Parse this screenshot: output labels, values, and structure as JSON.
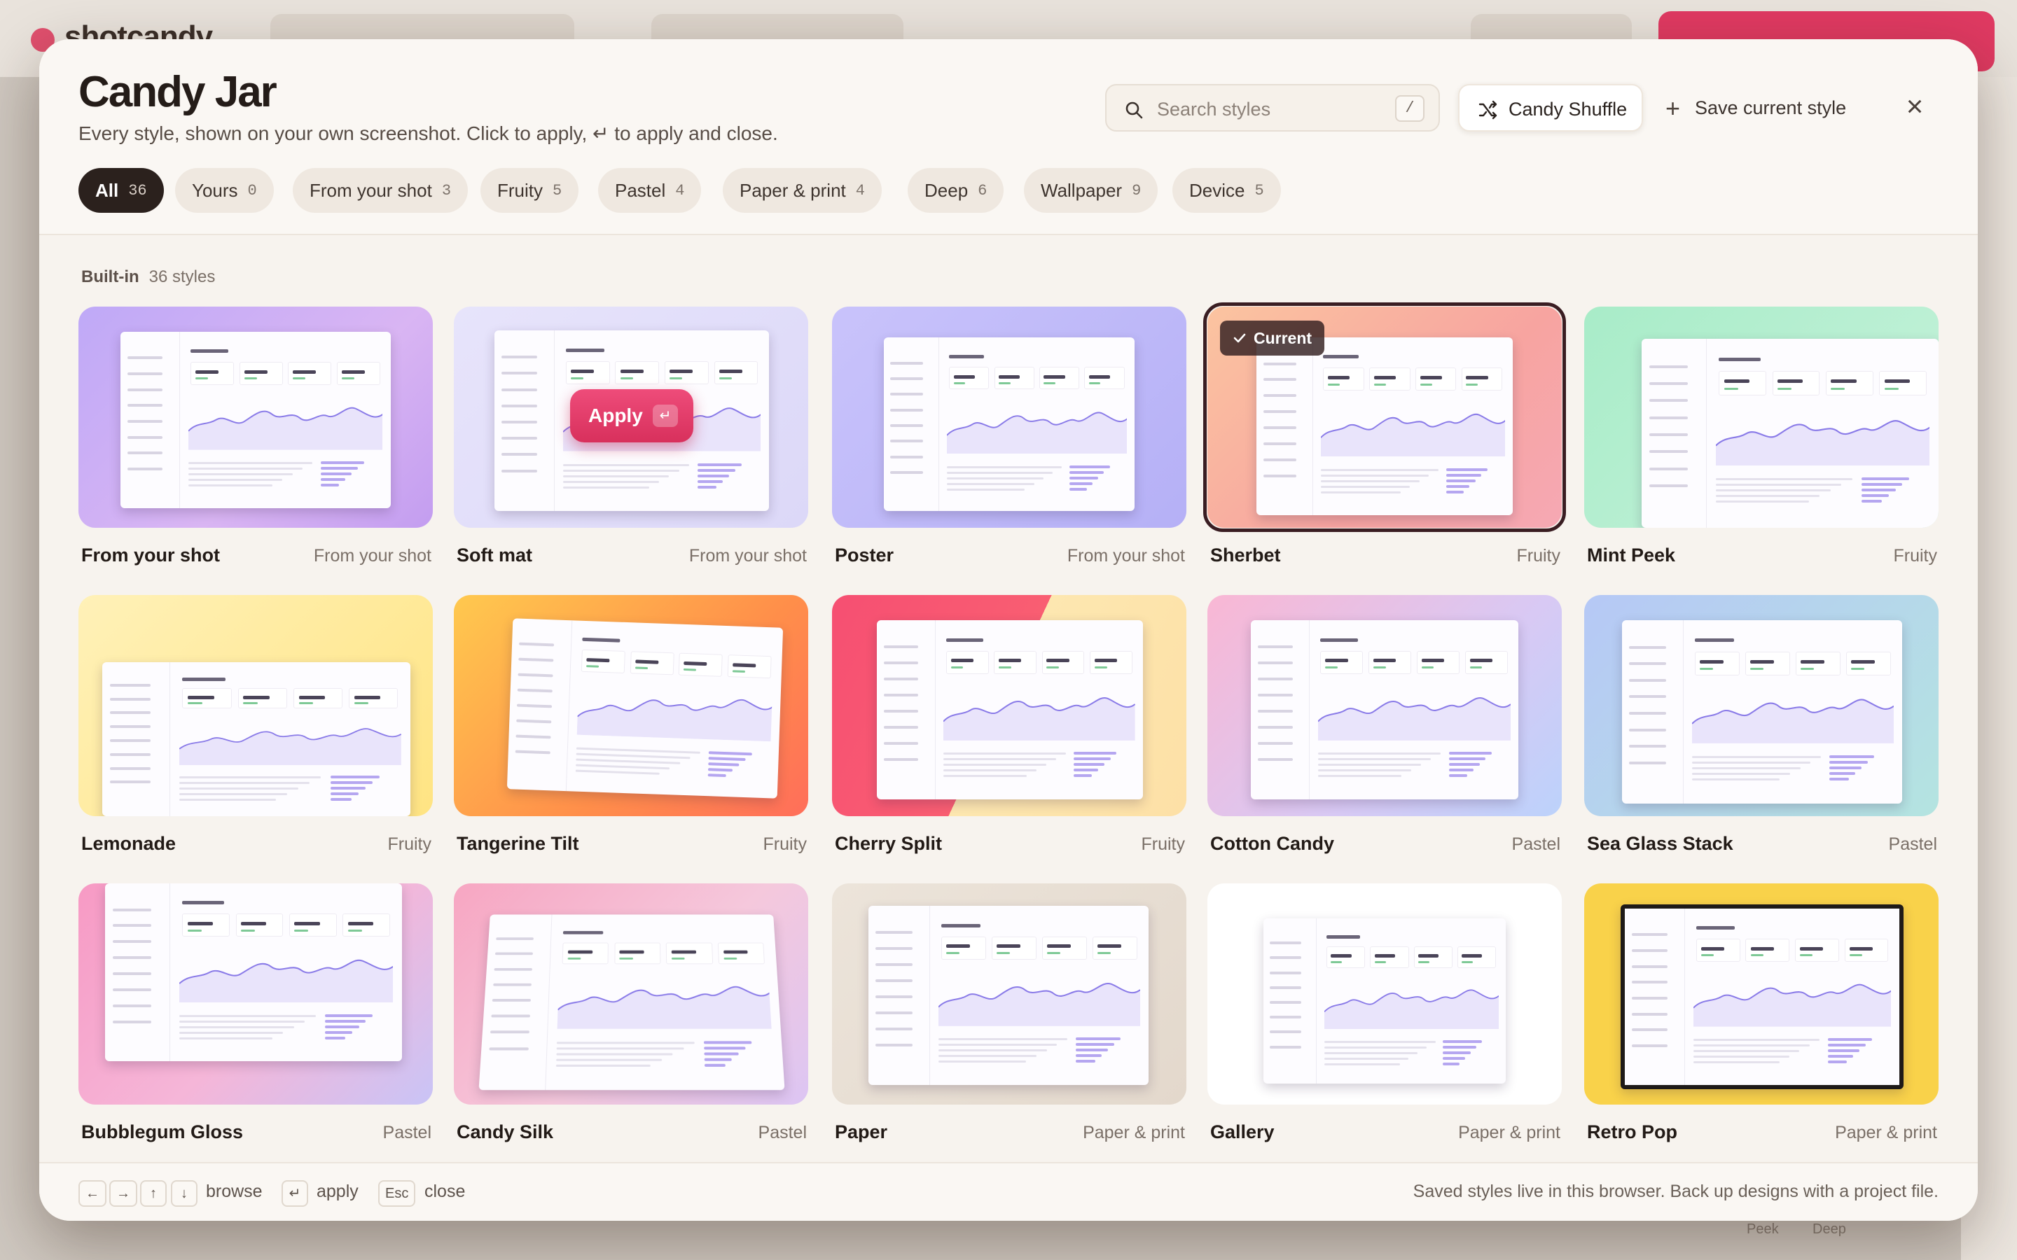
{
  "background": {
    "app_name": "shotcandy",
    "bottom_labels": [
      "Peek",
      "Deep"
    ]
  },
  "modal": {
    "title": "Candy Jar",
    "subtitle": "Every style, shown on your own screenshot. Click to apply, ↵ to apply and close.",
    "search": {
      "placeholder": "Search styles",
      "shortcut": "/"
    },
    "shuffle_label": "Candy Shuffle",
    "save_label": "Save current style",
    "close_label": "×"
  },
  "filters": [
    {
      "label": "All",
      "count": "36",
      "active": true
    },
    {
      "label": "Yours",
      "count": "0"
    },
    {
      "label": "From your shot",
      "count": "3"
    },
    {
      "label": "Fruity",
      "count": "5"
    },
    {
      "label": "Pastel",
      "count": "4"
    },
    {
      "label": "Paper & print",
      "count": "4"
    },
    {
      "label": "Deep",
      "count": "6"
    },
    {
      "label": "Wallpaper",
      "count": "9"
    },
    {
      "label": "Device",
      "count": "5"
    }
  ],
  "section": {
    "title": "Built-in",
    "count": "36 styles"
  },
  "badges": {
    "current": "Current",
    "apply": "Apply",
    "apply_key": "↵"
  },
  "styles": [
    {
      "name": "From your shot",
      "category": "From your shot",
      "bg": "linear-gradient(135deg,#bfa9f7 0%,#d9b5f3 60%,#c39df0 100%)"
    },
    {
      "name": "Soft mat",
      "category": "From your shot",
      "bg": "linear-gradient(135deg,#e7e4fb 0%,#dcd8f8 100%)"
    },
    {
      "name": "Poster",
      "category": "From your shot",
      "bg": "linear-gradient(135deg,#c9c3fb 0%,#b5b0f6 100%)"
    },
    {
      "name": "Sherbet",
      "category": "Fruity",
      "bg": "linear-gradient(135deg,#fbc4a0 0%,#f7a4a0 60%,#f6a8b4 100%)"
    },
    {
      "name": "Mint Peek",
      "category": "Fruity",
      "bg": "linear-gradient(135deg,#a8ecc8 0%,#c8f2dc 100%)"
    },
    {
      "name": "Lemonade",
      "category": "Fruity",
      "bg": "linear-gradient(135deg,#fff1b8 0%,#ffe483 100%)"
    },
    {
      "name": "Tangerine Tilt",
      "category": "Fruity",
      "bg": "linear-gradient(135deg,#ffc94e 0%,#ff8e4a 60%,#ff6e5a 100%)"
    },
    {
      "name": "Cherry Split",
      "category": "Fruity",
      "bg": "linear-gradient(115deg,#f64f72 0%,#f95e72 48%,#fde7b0 48%,#fde0a6 100%)"
    },
    {
      "name": "Cotton Candy",
      "category": "Pastel",
      "bg": "linear-gradient(135deg,#f9b7d4 0%,#d8c9f4 60%,#bcd2fb 100%)"
    },
    {
      "name": "Sea Glass Stack",
      "category": "Pastel",
      "bg": "linear-gradient(135deg,#b6c8f6 0%,#b4e4e0 100%)"
    },
    {
      "name": "Bubblegum Gloss",
      "category": "Pastel",
      "bg": "linear-gradient(135deg,#f79ac4 0%,#f5b6d8 55%,#c9c4f6 100%)"
    },
    {
      "name": "Candy Silk",
      "category": "Pastel",
      "bg": "linear-gradient(135deg,#f7a6c2 0%,#f5c8dc 55%,#dcc5f3 100%)"
    },
    {
      "name": "Paper",
      "category": "Paper & print",
      "bg": "linear-gradient(135deg,#ece4da 0%,#e3d8cc 100%)"
    },
    {
      "name": "Gallery",
      "category": "Paper & print",
      "bg": "#ffffff"
    },
    {
      "name": "Retro Pop",
      "category": "Paper & print",
      "bg": "#f9d24a"
    }
  ],
  "footer": {
    "keys": [
      "←",
      "→",
      "↑",
      "↓"
    ],
    "browse": "browse",
    "apply_key": "↵",
    "apply": "apply",
    "esc_key": "Esc",
    "close": "close",
    "note": "Saved styles live in this browser. Back up designs with a project file."
  }
}
